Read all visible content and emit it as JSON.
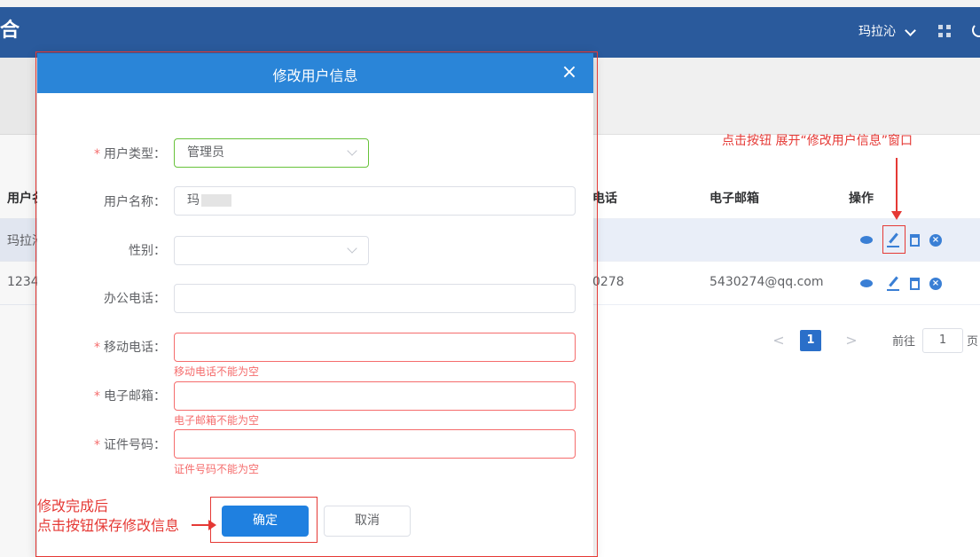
{
  "header": {
    "app_glyph": "合",
    "user_name": "玛拉沁"
  },
  "table": {
    "columns": [
      {
        "label": "用户名"
      },
      {
        "label": "电话"
      },
      {
        "label": "电子邮箱"
      },
      {
        "label": "操作"
      }
    ],
    "rows": [
      {
        "username": "玛拉沁",
        "phone": "",
        "email": ""
      },
      {
        "username": "1234",
        "phone": "0278",
        "email": "5430274@qq.com"
      }
    ]
  },
  "pagination": {
    "prev": "<",
    "current_page": "1",
    "next": ">",
    "goto_label": "前往",
    "goto_value": "1",
    "unit": "页"
  },
  "annotations": {
    "top": "点击按钮 展开“修改用户信息”窗口",
    "bottom_line1": "修改完成后",
    "bottom_line2": "点击按钮保存修改信息"
  },
  "dialog": {
    "title": "修改用户信息",
    "close": "×",
    "fields": {
      "user_type": {
        "label": "用户类型：",
        "value": "管理员"
      },
      "user_name": {
        "label": "用户名称：",
        "value": "玛"
      },
      "gender": {
        "label": "性别：",
        "value": ""
      },
      "office_phone": {
        "label": "办公电话：",
        "value": ""
      },
      "mobile": {
        "label": "移动电话：",
        "value": "",
        "error": "移动电话不能为空"
      },
      "email": {
        "label": "电子邮箱：",
        "value": "",
        "error": "电子邮箱不能为空"
      },
      "id_number": {
        "label": "证件号码：",
        "value": "",
        "error": "证件号码不能为空"
      }
    },
    "confirm_label": "确定",
    "cancel_label": "取消"
  },
  "colors": {
    "header_bg": "#2a5a9c",
    "dialog_header": "#2a85d8",
    "primary": "#1f80e0",
    "error": "#f56c6c",
    "annotation": "#e53935"
  }
}
